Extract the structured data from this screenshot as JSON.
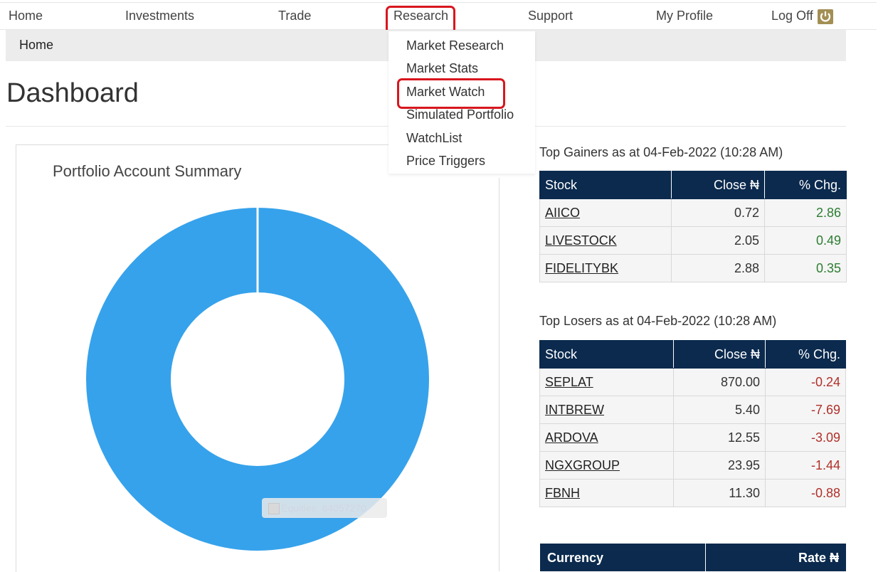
{
  "nav": {
    "items": [
      {
        "label": "Home"
      },
      {
        "label": "Investments"
      },
      {
        "label": "Trade"
      },
      {
        "label": "Research"
      },
      {
        "label": "Support"
      },
      {
        "label": "My Profile"
      },
      {
        "label": "Log Off"
      }
    ],
    "active": "Research",
    "logoff_icon": "power-icon"
  },
  "breadcrumb": {
    "current": "Home"
  },
  "dropdown": {
    "items": [
      {
        "label": "Market Research"
      },
      {
        "label": "Market Stats"
      },
      {
        "label": "Market Watch"
      },
      {
        "label": "Simulated Portfolio"
      },
      {
        "label": "WatchList"
      },
      {
        "label": "Price Triggers"
      }
    ],
    "highlighted": "Market Watch"
  },
  "page": {
    "title": "Dashboard"
  },
  "portfolio": {
    "title": "Portfolio Account Summary",
    "tooltip": "Equities: 64057270"
  },
  "chart_data": {
    "type": "pie",
    "categories": [
      "Equities"
    ],
    "values": [
      64057270
    ],
    "title": "Portfolio Account Summary",
    "colors": [
      "#36a2eb"
    ]
  },
  "gainers": {
    "caption": "Top Gainers as at 04-Feb-2022 (10:28 AM)",
    "headers": [
      "Stock",
      "Close ₦",
      "% Chg."
    ],
    "rows": [
      {
        "stock": "AIICO",
        "close": "0.72",
        "chg": "2.86"
      },
      {
        "stock": "LIVESTOCK",
        "close": "2.05",
        "chg": "0.49"
      },
      {
        "stock": "FIDELITYBK",
        "close": "2.88",
        "chg": "0.35"
      }
    ]
  },
  "losers": {
    "caption": "Top Losers as at 04-Feb-2022 (10:28 AM)",
    "headers": [
      "Stock",
      "Close ₦",
      "% Chg."
    ],
    "rows": [
      {
        "stock": "SEPLAT",
        "close": "870.00",
        "chg": "-0.24"
      },
      {
        "stock": "INTBREW",
        "close": "5.40",
        "chg": "-7.69"
      },
      {
        "stock": "ARDOVA",
        "close": "12.55",
        "chg": "-3.09"
      },
      {
        "stock": "NGXGROUP",
        "close": "23.95",
        "chg": "-1.44"
      },
      {
        "stock": "FBNH",
        "close": "11.30",
        "chg": "-0.88"
      }
    ]
  },
  "currency": {
    "headers": [
      "Currency",
      "Rate ₦"
    ]
  },
  "colors": {
    "header_navy": "#0b2a4e",
    "highlight_red": "#d9161e",
    "donut_blue": "#36a2eb",
    "gain_green": "#2e7d32",
    "loss_red": "#b0302a"
  }
}
